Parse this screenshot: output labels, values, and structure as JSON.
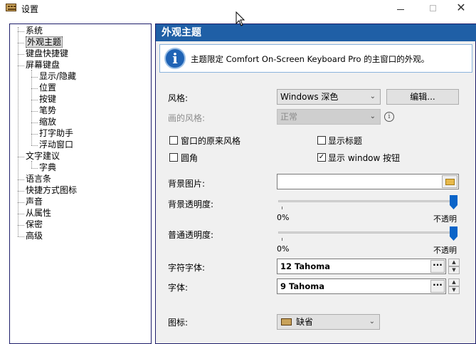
{
  "window": {
    "title": "设置"
  },
  "tree": {
    "items": [
      {
        "label": "系统",
        "level": 0,
        "selected": false
      },
      {
        "label": "外观主题",
        "level": 0,
        "selected": true
      },
      {
        "label": "键盘快捷键",
        "level": 0,
        "selected": false
      },
      {
        "label": "屏幕键盘",
        "level": 0,
        "selected": false
      },
      {
        "label": "显示/隐藏",
        "level": 1,
        "selected": false
      },
      {
        "label": "位置",
        "level": 1,
        "selected": false
      },
      {
        "label": "按键",
        "level": 1,
        "selected": false
      },
      {
        "label": "笔势",
        "level": 1,
        "selected": false
      },
      {
        "label": "缩放",
        "level": 1,
        "selected": false
      },
      {
        "label": "打字助手",
        "level": 1,
        "selected": false
      },
      {
        "label": "浮动窗口",
        "level": 1,
        "selected": false
      },
      {
        "label": "文字建议",
        "level": 0,
        "selected": false
      },
      {
        "label": "字典",
        "level": 1,
        "selected": false
      },
      {
        "label": "语言条",
        "level": 0,
        "selected": false
      },
      {
        "label": "快捷方式图标",
        "level": 0,
        "selected": false
      },
      {
        "label": "声音",
        "level": 0,
        "selected": false
      },
      {
        "label": "从属性",
        "level": 0,
        "selected": false
      },
      {
        "label": "保密",
        "level": 0,
        "selected": false
      },
      {
        "label": "高级",
        "level": 0,
        "selected": false
      }
    ]
  },
  "panel": {
    "header": "外观主题",
    "info_text": "主题限定 Comfort On-Screen Keyboard Pro 的主窗口的外观。",
    "style_label": "风格:",
    "style_value": "Windows 深色",
    "edit_button": "编辑...",
    "draw_style_label": "画的风格:",
    "draw_style_value": "正常",
    "chk_original_style": {
      "label": "窗口的原来风格",
      "checked": false
    },
    "chk_show_title": {
      "label": "显示标题",
      "checked": false
    },
    "chk_rounded": {
      "label": "圆角",
      "checked": false
    },
    "chk_show_window_buttons": {
      "label": "显示 window 按钮",
      "checked": true
    },
    "bg_image_label": "背景图片:",
    "bg_image_value": "",
    "bg_opacity_label": "背景透明度:",
    "bg_opacity_min": "0%",
    "bg_opacity_max": "不透明",
    "bg_opacity_level": 1.0,
    "normal_opacity_label": "普通透明度:",
    "normal_opacity_min": "0%",
    "normal_opacity_max": "不透明",
    "normal_opacity_level": 1.0,
    "char_font_label": "字符字体:",
    "char_font_value": "12 Tahoma",
    "font_label": "字体:",
    "font_value": "9 Tahoma",
    "icon_label": "图标:",
    "icon_value": "缺省"
  },
  "icons": {
    "app": "keyboard-icon",
    "info": "info-icon",
    "folder": "folder-icon",
    "ellipsis": "ellipsis-icon",
    "dropdown": "chevron-down-icon"
  },
  "colors": {
    "header_bg": "#1f5fa6",
    "slider_thumb": "#0a64c8"
  }
}
